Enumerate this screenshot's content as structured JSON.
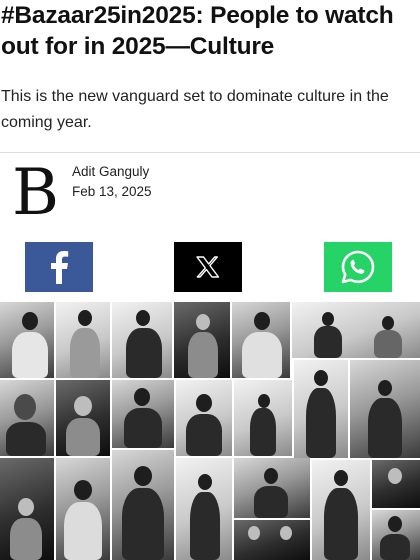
{
  "article": {
    "headline": "#Bazaar25in2025: People to watch out for in 2025—Culture",
    "standfirst": "This is the new vanguard set to dominate culture in the coming year.",
    "publication_logo_letter": "B",
    "author": "Adit Ganguly",
    "date": "Feb 13, 2025"
  },
  "share": {
    "facebook_icon": "facebook-icon",
    "x_icon": "x-icon",
    "whatsapp_icon": "whatsapp-icon",
    "colors": {
      "facebook": "#3b5998",
      "x": "#000000",
      "whatsapp": "#25d366"
    }
  },
  "collage": {
    "description_icon": "photo-collage"
  }
}
